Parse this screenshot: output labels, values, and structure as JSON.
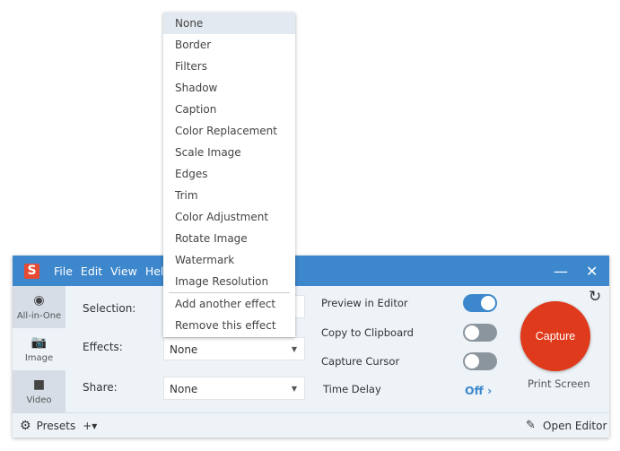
{
  "app": {
    "logo": "S",
    "menu": [
      "File",
      "Edit",
      "View",
      "Help"
    ],
    "minimize": "—",
    "close": "✕"
  },
  "sidebar": {
    "tabs": [
      {
        "label": "All-in-One",
        "icon": "◉"
      },
      {
        "label": "Image",
        "icon": "📷"
      },
      {
        "label": "Video",
        "icon": "■"
      }
    ]
  },
  "fields": {
    "selection_label": "Selection:",
    "effects_label": "Effects:",
    "effects_value": "None",
    "share_label": "Share:",
    "share_value": "None"
  },
  "options": {
    "preview": {
      "label": "Preview in Editor",
      "on": true
    },
    "clipboard": {
      "label": "Copy to Clipboard",
      "on": false
    },
    "cursor": {
      "label": "Capture Cursor",
      "on": false
    },
    "delay": {
      "label": "Time Delay",
      "value": "Off"
    }
  },
  "capture": {
    "label": "Capture",
    "hotkey": "Print Screen",
    "reset_icon": "↻"
  },
  "footer": {
    "presets": "Presets",
    "add": "+▾",
    "open_editor": "Open Editor"
  },
  "dropdown": {
    "items": [
      "None",
      "Border",
      "Filters",
      "Shadow",
      "Caption",
      "Color Replacement",
      "Scale Image",
      "Edges",
      "Trim",
      "Color Adjustment",
      "Rotate Image",
      "Watermark",
      "Image Resolution"
    ],
    "actions": [
      "Add another effect",
      "Remove this effect"
    ]
  },
  "colors": {
    "accent": "#3d87cc",
    "capture": "#df3a1b"
  }
}
